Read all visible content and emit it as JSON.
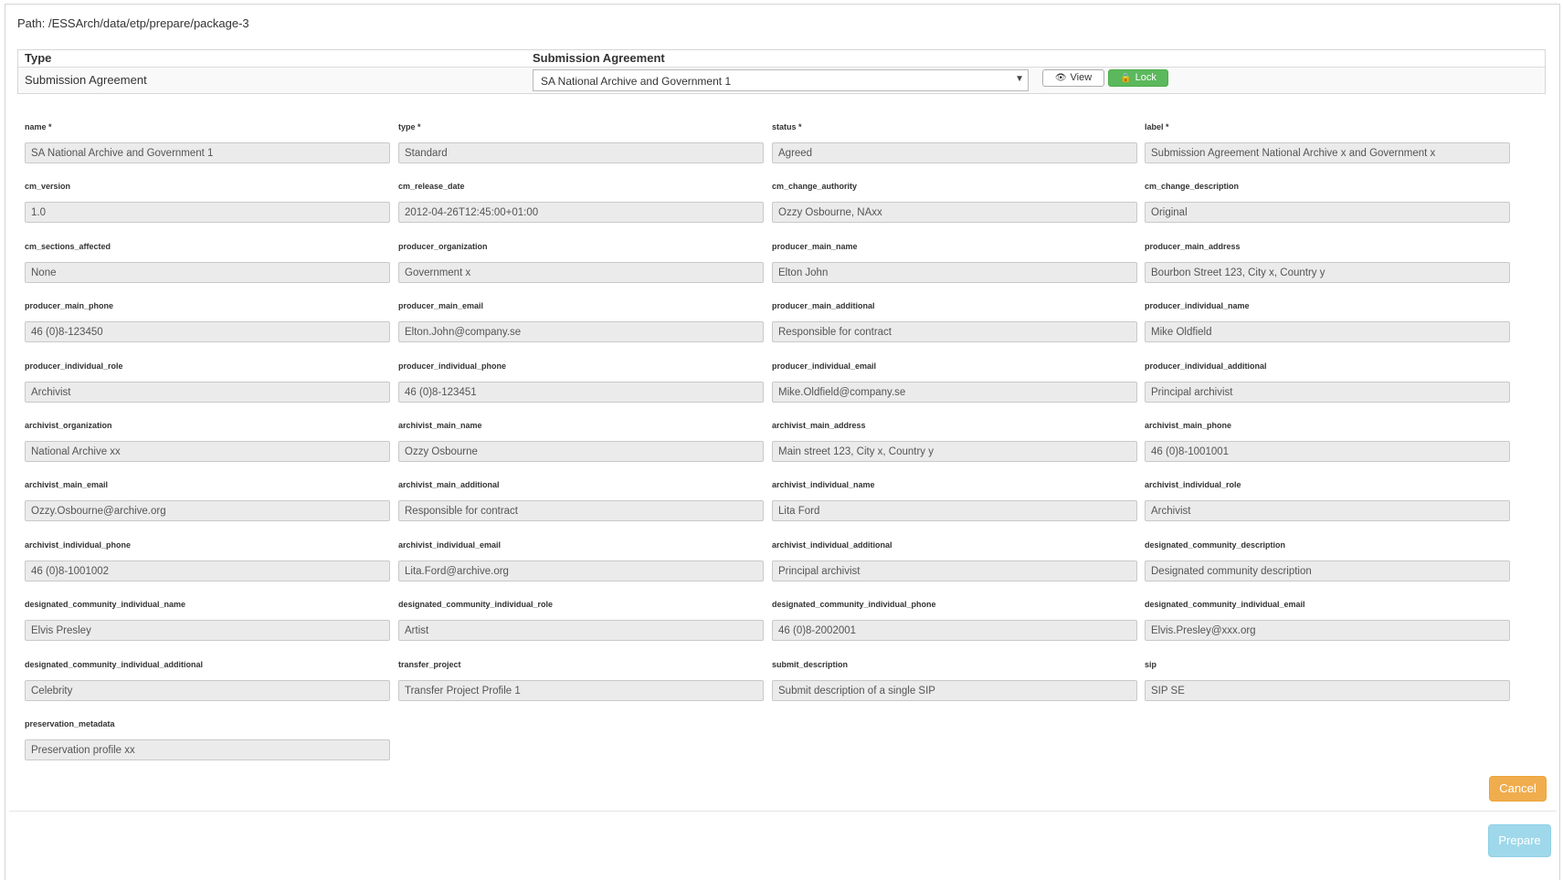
{
  "path": "Path: /ESSArch/data/etp/prepare/package-3",
  "sa_table": {
    "col_type": "Type",
    "col_sa": "Submission Agreement",
    "row_type": "Submission Agreement",
    "selected": "SA National Archive and Government 1",
    "view_label": "View",
    "lock_label": "Lock"
  },
  "fields": [
    {
      "label": "name *",
      "value": "SA National Archive and Government 1"
    },
    {
      "label": "type *",
      "value": "Standard"
    },
    {
      "label": "status *",
      "value": "Agreed"
    },
    {
      "label": "label *",
      "value": "Submission Agreement National Archive x and Government x"
    },
    {
      "label": "cm_version",
      "value": "1.0"
    },
    {
      "label": "cm_release_date",
      "value": "2012-04-26T12:45:00+01:00"
    },
    {
      "label": "cm_change_authority",
      "value": "Ozzy Osbourne, NAxx"
    },
    {
      "label": "cm_change_description",
      "value": "Original"
    },
    {
      "label": "cm_sections_affected",
      "value": "None"
    },
    {
      "label": "producer_organization",
      "value": "Government x"
    },
    {
      "label": "producer_main_name",
      "value": "Elton John"
    },
    {
      "label": "producer_main_address",
      "value": "Bourbon Street 123, City x, Country y"
    },
    {
      "label": "producer_main_phone",
      "value": "46 (0)8-123450"
    },
    {
      "label": "producer_main_email",
      "value": "Elton.John@company.se"
    },
    {
      "label": "producer_main_additional",
      "value": "Responsible for contract"
    },
    {
      "label": "producer_individual_name",
      "value": "Mike Oldfield"
    },
    {
      "label": "producer_individual_role",
      "value": "Archivist"
    },
    {
      "label": "producer_individual_phone",
      "value": "46 (0)8-123451"
    },
    {
      "label": "producer_individual_email",
      "value": "Mike.Oldfield@company.se"
    },
    {
      "label": "producer_individual_additional",
      "value": "Principal archivist"
    },
    {
      "label": "archivist_organization",
      "value": "National Archive xx"
    },
    {
      "label": "archivist_main_name",
      "value": "Ozzy Osbourne"
    },
    {
      "label": "archivist_main_address",
      "value": "Main street 123, City x, Country y"
    },
    {
      "label": "archivist_main_phone",
      "value": "46 (0)8-1001001"
    },
    {
      "label": "archivist_main_email",
      "value": "Ozzy.Osbourne@archive.org"
    },
    {
      "label": "archivist_main_additional",
      "value": "Responsible for contract"
    },
    {
      "label": "archivist_individual_name",
      "value": "Lita Ford"
    },
    {
      "label": "archivist_individual_role",
      "value": "Archivist"
    },
    {
      "label": "archivist_individual_phone",
      "value": "46 (0)8-1001002"
    },
    {
      "label": "archivist_individual_email",
      "value": "Lita.Ford@archive.org"
    },
    {
      "label": "archivist_individual_additional",
      "value": "Principal archivist"
    },
    {
      "label": "designated_community_description",
      "value": "Designated community description"
    },
    {
      "label": "designated_community_individual_name",
      "value": "Elvis Presley"
    },
    {
      "label": "designated_community_individual_role",
      "value": "Artist"
    },
    {
      "label": "designated_community_individual_phone",
      "value": "46 (0)8-2002001"
    },
    {
      "label": "designated_community_individual_email",
      "value": "Elvis.Presley@xxx.org"
    },
    {
      "label": "designated_community_individual_additional",
      "value": "Celebrity"
    },
    {
      "label": "transfer_project",
      "value": "Transfer Project Profile 1"
    },
    {
      "label": "submit_description",
      "value": "Submit description of a single SIP"
    },
    {
      "label": "sip",
      "value": "SIP SE"
    },
    {
      "label": "preservation_metadata",
      "value": "Preservation profile xx"
    }
  ],
  "buttons": {
    "cancel": "Cancel",
    "prepare": "Prepare"
  },
  "colors": {
    "lock_green": "#5cb85c",
    "cancel_orange": "#f0ad4e",
    "prepare_disabled_blue": "#9fd8ea",
    "input_bg": "#ebebeb"
  }
}
